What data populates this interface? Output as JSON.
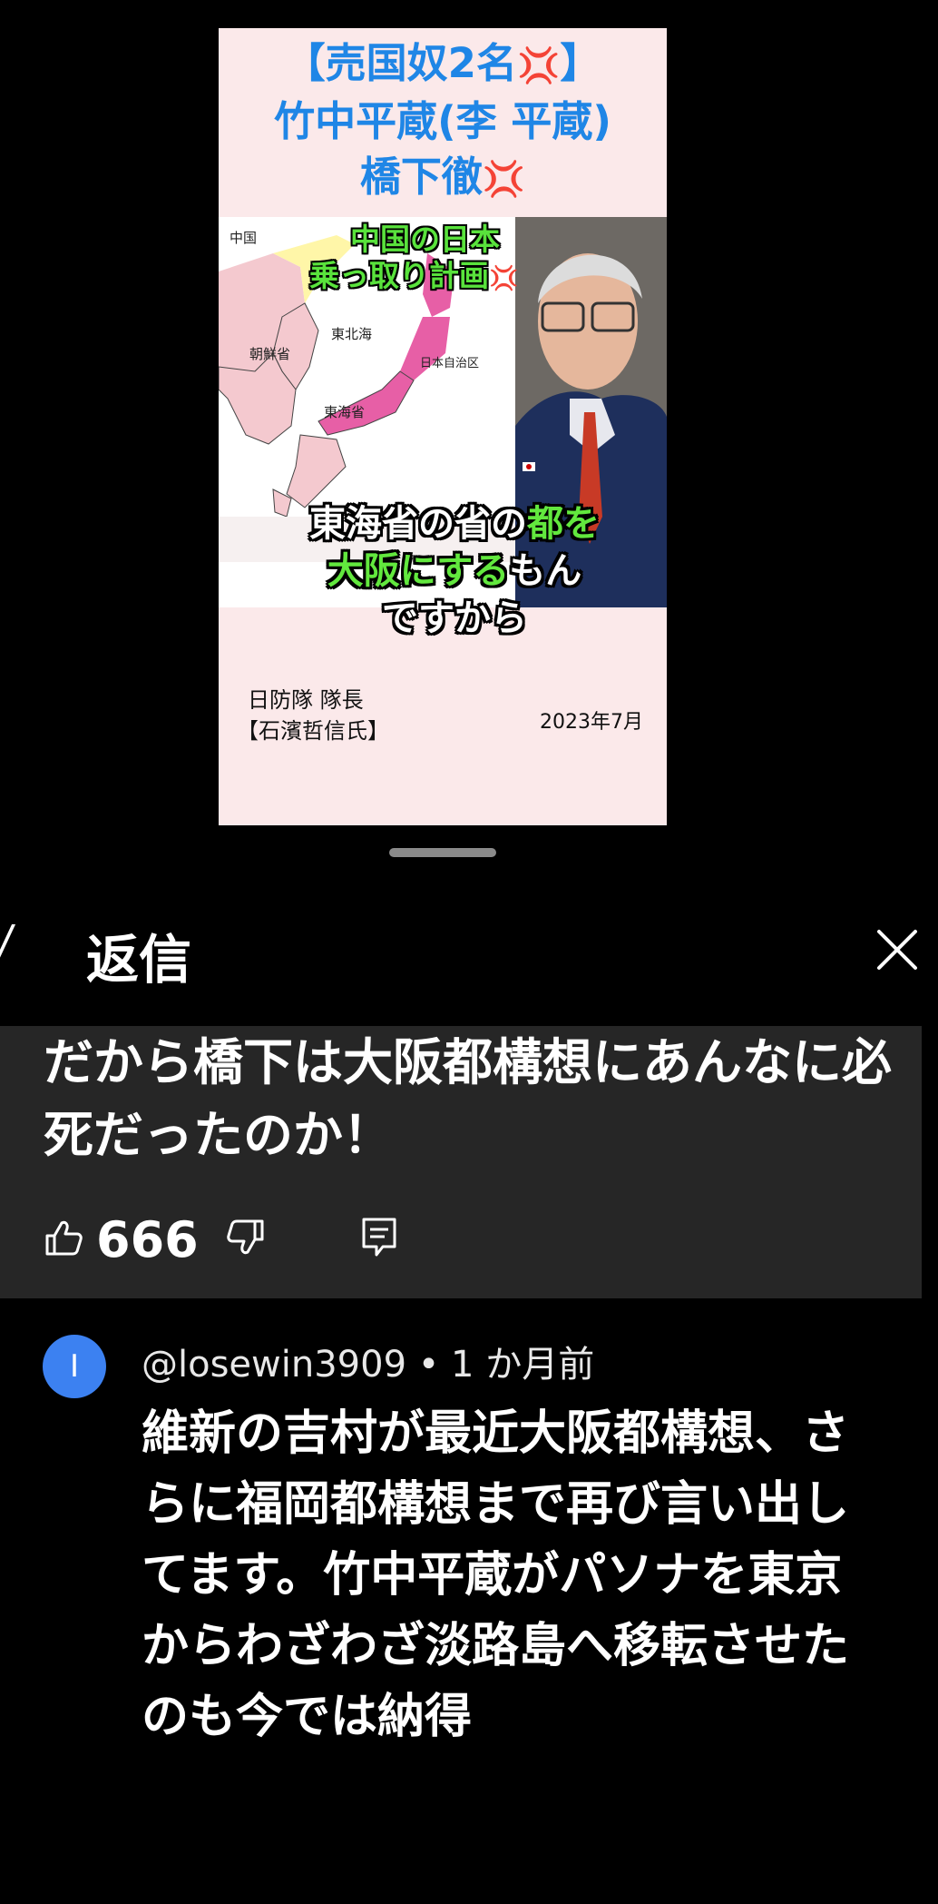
{
  "video": {
    "title_lines": [
      "【売国奴2名",
      "竹中平蔵(李 平蔵)",
      "橋下徹"
    ],
    "angry_glyph": "💢",
    "map_labels": {
      "china": "中国",
      "east_north_sea": "東北海",
      "korea": "朝鮮省",
      "japan_region": "日本自治区",
      "east_sea": "東海省"
    },
    "plan_caption_1": "中国の日本",
    "plan_caption_2": "乗っ取り計画",
    "subtitle_line1_a": "東海省の省の",
    "subtitle_line1_b": "都を",
    "subtitle_line2_a": "大阪にする",
    "subtitle_line2_b": "もん",
    "subtitle_line3": "ですから",
    "footer_line1": "日防隊 隊長",
    "footer_line2": "【石濱哲信氏】",
    "date": "2023年7月"
  },
  "sheet": {
    "title": "返信",
    "close_icon": "close-icon"
  },
  "parent_comment": {
    "text": "だから橋下は大阪都構想にあんなに必死だったのか！",
    "likes": "666"
  },
  "reply": {
    "avatar_letter": "I",
    "avatar_color": "#3c81f1",
    "handle": "@losewin3909",
    "time": "• 1 か月前",
    "text": "維新の吉村が最近大阪都構想、さらに福岡都構想まで再び言い出してます。竹中平蔵がパソナを東京からわざわざ淡路島へ移転させたのも今では納得"
  }
}
